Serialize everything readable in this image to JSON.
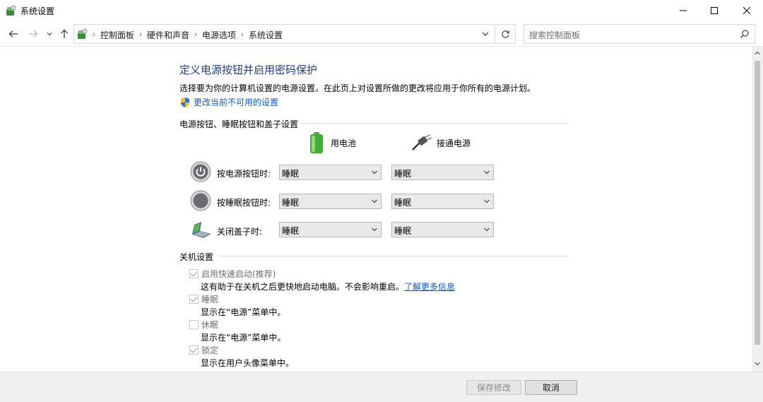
{
  "window": {
    "title": "系统设置"
  },
  "nav": {
    "breadcrumbs": [
      "控制面板",
      "硬件和声音",
      "电源选项",
      "系统设置"
    ],
    "search_placeholder": "搜索控制面板"
  },
  "main": {
    "heading": "定义电源按钮并启用密码保护",
    "description": "选择要为你的计算机设置的电源设置。在此页上对设置所做的更改将应用于你所有的电源计划。",
    "change_link": "更改当前不可用的设置",
    "power_section": {
      "title": "电源按钮、睡眠按钮和盖子设置",
      "col_battery": "用电池",
      "col_plugged": "接通电源",
      "rows": [
        {
          "label": "按电源按钮时:",
          "battery": "睡眠",
          "plugged": "睡眠"
        },
        {
          "label": "按睡眠按钮时:",
          "battery": "睡眠",
          "plugged": "睡眠"
        },
        {
          "label": "关闭盖子时:",
          "battery": "睡眠",
          "plugged": "睡眠"
        }
      ]
    },
    "shutdown_section": {
      "title": "关机设置",
      "items": [
        {
          "label": "启用快速启动(推荐)",
          "checked": true,
          "desc": "这有助于在关机之后更快地启动电脑。不会影响重启。",
          "link": "了解更多信息"
        },
        {
          "label": "睡眠",
          "checked": true,
          "desc": "显示在“电源”菜单中。"
        },
        {
          "label": "休眠",
          "checked": false,
          "desc": "显示在“电源”菜单中。"
        },
        {
          "label": "锁定",
          "checked": true,
          "desc": "显示在用户头像菜单中。"
        }
      ]
    }
  },
  "footer": {
    "save_label": "保存修改",
    "cancel_label": "取消"
  },
  "colors": {
    "heading": "#23408e",
    "link": "#0a5ad0",
    "footer_bg": "#f0f0f0"
  }
}
